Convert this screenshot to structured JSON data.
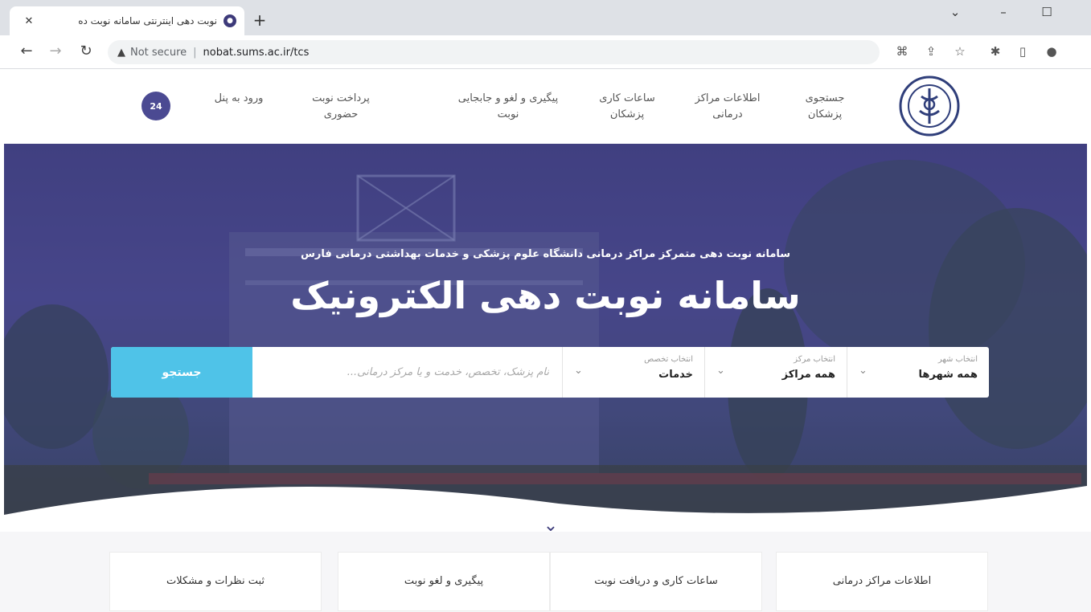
{
  "browser": {
    "tab_title": "نوبت دهی اینترنتی سامانه نوبت ده",
    "tab_close": "✕",
    "new_tab": "+",
    "not_secure": "Not secure",
    "separator": "|",
    "url": "nobat.sums.ac.ir/tcs",
    "win_chevron": "⌄",
    "win_minimize": "–",
    "win_maximize": "☐"
  },
  "header": {
    "nav": [
      {
        "label": "جستجوی پزشکان"
      },
      {
        "label": "اطلاعات مراکز درمانی"
      },
      {
        "label": "ساعات کاری پزشکان"
      },
      {
        "label": "پیگیری و لغو و جابجایی نوبت"
      },
      {
        "label": "پرداخت نوبت حضوری"
      },
      {
        "label": "ورود به پنل"
      }
    ],
    "support_badge": "24"
  },
  "hero": {
    "subtitle": "سامانه نوبت دهی متمرکز مراکز درمانی دانشگاه علوم پزشکی و خدمات بهداشتی درمانی فارس",
    "title": "سامانه نوبت دهی الکترونیک"
  },
  "search": {
    "city_label": "انتخاب شهر",
    "city_value": "همه شهرها",
    "center_label": "انتخاب مرکز",
    "center_value": "همه مراکز",
    "specialty_label": "انتخاب تخصص",
    "specialty_value": "خدمات",
    "placeholder": "نام پزشک، تخصص، خدمت و یا مرکز درمانی...",
    "button": "جستجو"
  },
  "cards": [
    {
      "label": "اطلاعات مراکز درمانی"
    },
    {
      "label": "ساعات کاری و دریافت نوبت"
    },
    {
      "label": "پیگیری و لغو نوبت"
    },
    {
      "label": "ثبت نظرات و مشکلات"
    }
  ],
  "colors": {
    "brand_purple": "#3e3d7c",
    "search_button": "#4fc3e8"
  }
}
